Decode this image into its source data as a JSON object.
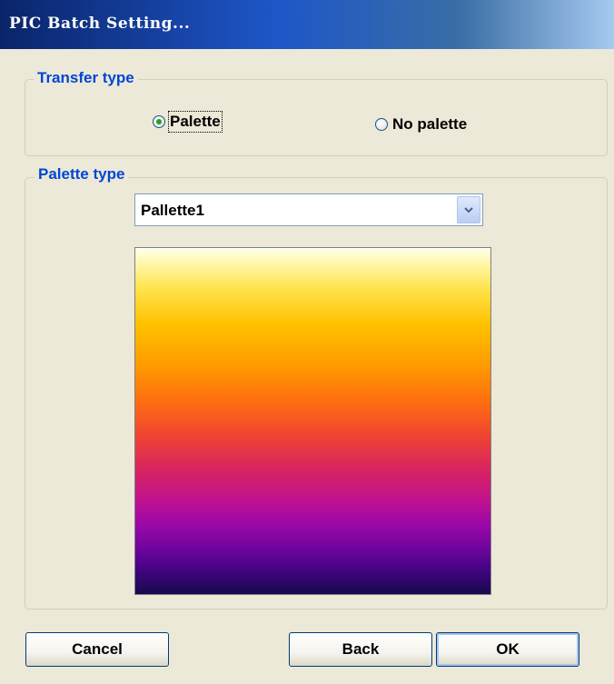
{
  "window": {
    "title": "PIC Batch Setting..."
  },
  "transfer_type": {
    "legend": "Transfer type",
    "options": [
      {
        "label": "Palette",
        "selected": true
      },
      {
        "label": "No palette",
        "selected": false
      }
    ]
  },
  "palette_type": {
    "legend": "Palette type",
    "selected_value": "Pallette1",
    "preview_colors": [
      "#FFFFF0",
      "#FFE24A",
      "#FFC200",
      "#FF9A00",
      "#FF7010",
      "#F04530",
      "#D82460",
      "#C01290",
      "#9A08A8",
      "#6E049E",
      "#420480",
      "#160A4E"
    ]
  },
  "buttons": {
    "cancel": "Cancel",
    "back": "Back",
    "ok": "OK"
  },
  "colors": {
    "accent_legend": "#0046D5",
    "titlebar_start": "#0A246A",
    "titlebar_end": "#A6CAF0",
    "radio_dot": "#21A121"
  }
}
